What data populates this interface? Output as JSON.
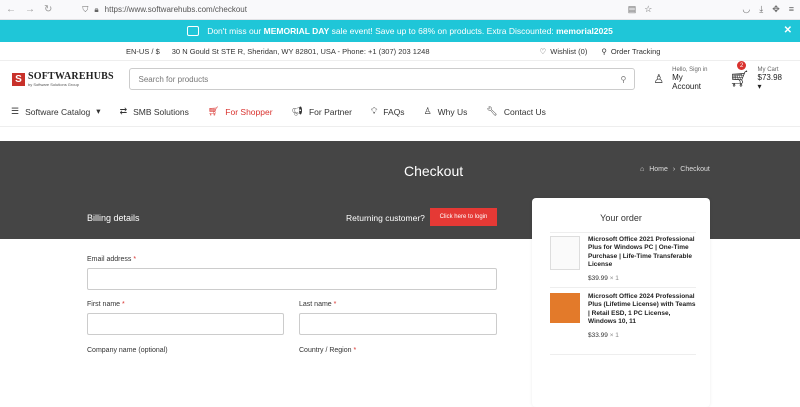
{
  "browser": {
    "url": "https://www.softwarehubs.com/checkout"
  },
  "promo": {
    "pre": "Don't miss our",
    "bold1": "MEMORIAL DAY",
    "mid": "sale event! Save up to 68% on products. Extra Discounted:",
    "bold2": "memorial2025"
  },
  "infobar": {
    "lang": "EN-US / $",
    "address": "30 N Gould St STE R, Sheridan, WY 82801, USA - Phone: +1 (307) 203 1248",
    "wishlist": "Wishlist (0)",
    "order_tracking": "Order Tracking"
  },
  "header": {
    "logo_name": "SOFTWAREHUBS",
    "logo_sub": "by Software Solutions Group",
    "search_placeholder": "Search for products",
    "account_small": "Hello, Sign in",
    "account_big": "My Account",
    "cart_badge": "2",
    "cart_small": "My Cart",
    "cart_total": "$73.98"
  },
  "menu": {
    "catalog": "Software Catalog",
    "smb": "SMB Solutions",
    "shopper": "For Shopper",
    "partner": "For Partner",
    "faqs": "FAQs",
    "whyus": "Why Us",
    "contact": "Contact Us"
  },
  "hero": {
    "title": "Checkout",
    "crumb_home": "Home",
    "crumb_current": "Checkout",
    "billing": "Billing details",
    "returning": "Returning customer?",
    "login_btn": "Click here to login"
  },
  "form": {
    "email": "Email address",
    "first": "First name",
    "last": "Last name",
    "company": "Company name (optional)",
    "country": "Country / Region"
  },
  "order": {
    "heading": "Your order",
    "items": [
      {
        "name": "Microsoft Office 2021 Professional Plus for Windows PC | One-Time Purchase | Life-Time Transferable License",
        "price": "$39.99",
        "qty": "× 1"
      },
      {
        "name": "Microsoft Office 2024 Professional Plus (Lifetime License) with Teams | Retail ESD, 1 PC License, Windows 10, 11",
        "price": "$33.99",
        "qty": "× 1"
      }
    ]
  }
}
